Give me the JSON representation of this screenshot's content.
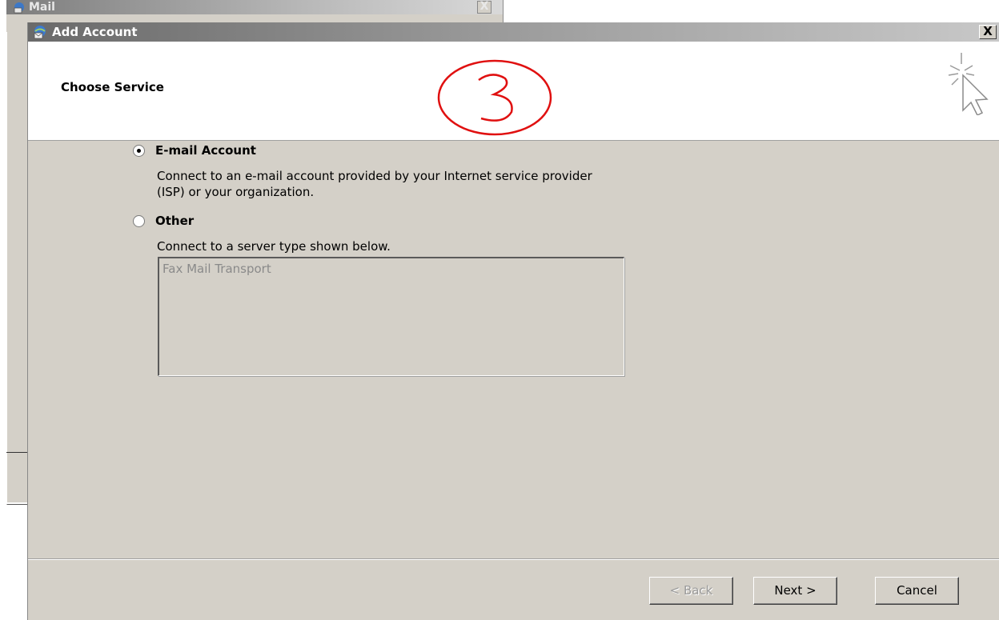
{
  "background_window": {
    "title": "Mail",
    "close_label": "X"
  },
  "dialog": {
    "title": "Add Account",
    "close_label": "X",
    "header_title": "Choose Service",
    "annotation": "3"
  },
  "options": {
    "email": {
      "label": "E-mail Account",
      "description_line1": "Connect to an e-mail account provided by your Internet service provider",
      "description_line2": "(ISP) or your organization.",
      "selected": true
    },
    "other": {
      "label": "Other",
      "description": "Connect to a server type shown below.",
      "selected": false
    }
  },
  "server_list": {
    "items": [
      "Fax Mail Transport"
    ],
    "enabled": false
  },
  "buttons": {
    "back": "< Back",
    "next": "Next >",
    "cancel": "Cancel"
  },
  "colors": {
    "dialog_background": "#d4d0c8",
    "annotation": "#e01010",
    "disabled_text": "#8a8a8a"
  },
  "icons": {
    "title": "mail-globe-icon",
    "wizard": "wizard-cursor-sparkle-icon"
  }
}
